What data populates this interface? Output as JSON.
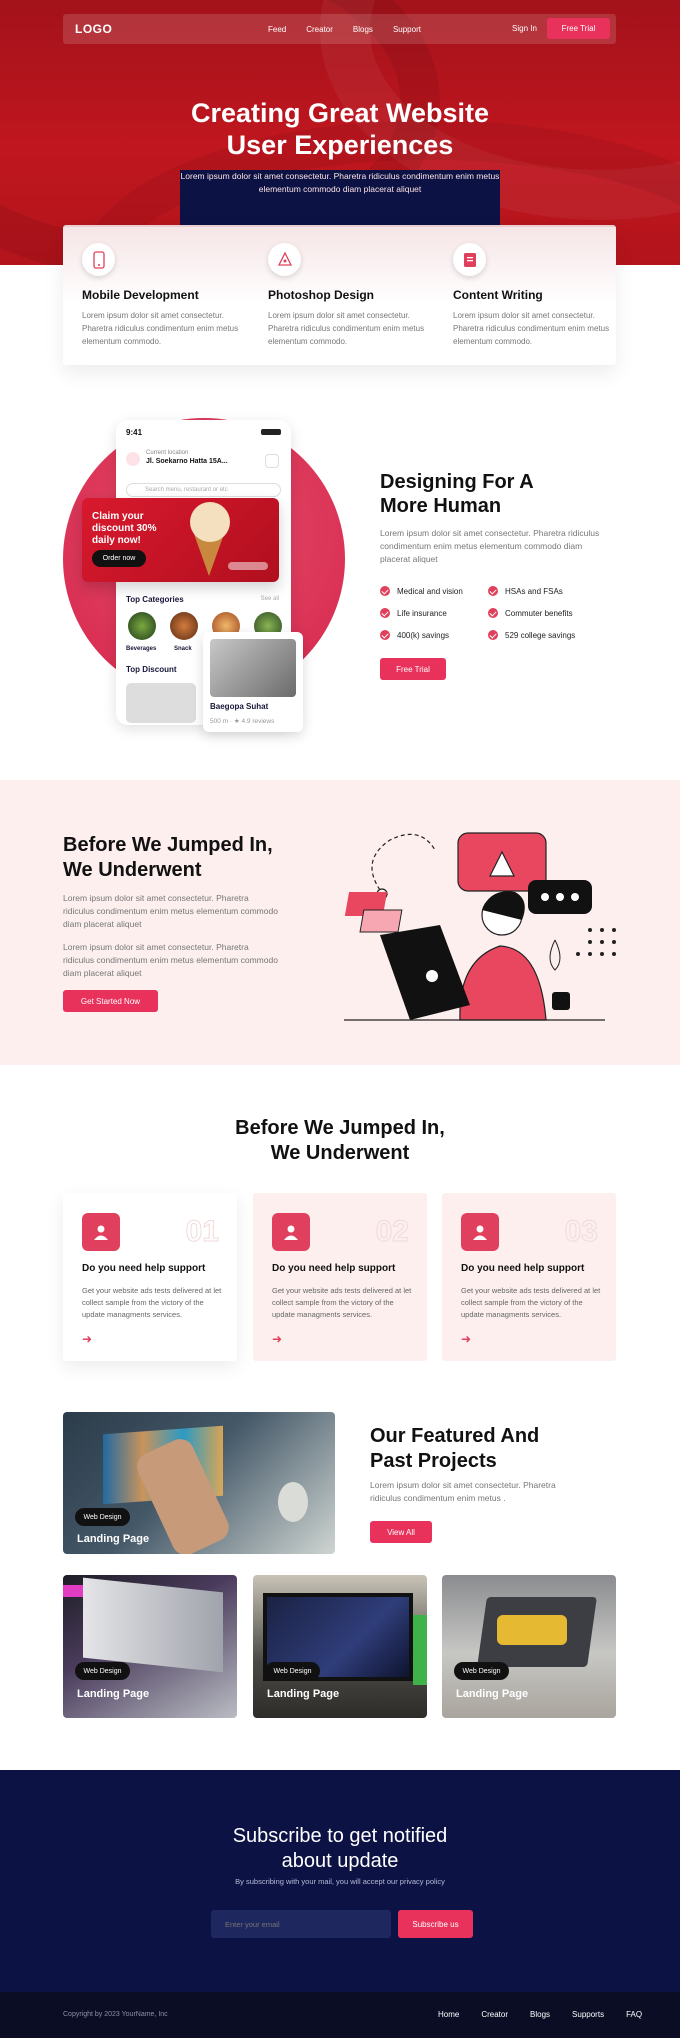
{
  "nav": {
    "logo": "LOGO",
    "links": [
      "Feed",
      "Creator",
      "Blogs",
      "Support"
    ],
    "signin": "Sign In",
    "cta": "Free Trial"
  },
  "hero": {
    "title_line1": "Creating Great Website",
    "title_line2": "User Experiences",
    "subtitle": "Lorem ipsum dolor sit amet consectetur. Pharetra ridiculus condimentum enim metus elementum commodo diam placerat aliquet"
  },
  "services": [
    {
      "title": "Mobile Development",
      "text": "Lorem ipsum dolor sit amet consectetur. Pharetra ridiculus condimentum enim metus elementum commodo.",
      "icon": "phone-icon"
    },
    {
      "title": "Photoshop Design",
      "text": "Lorem ipsum dolor sit amet consectetur. Pharetra ridiculus condimentum enim metus elementum commodo.",
      "icon": "pen-tool-icon"
    },
    {
      "title": "Content Writing",
      "text": "Lorem ipsum dolor sit amet consectetur. Pharetra ridiculus condimentum enim metus elementum commodo.",
      "icon": "document-icon"
    }
  ],
  "app_mock": {
    "time": "9:41",
    "location_label": "Current location",
    "location": "Jl. Soekarno Hatta 15A...",
    "search_placeholder": "Search menu, restaurant or etc",
    "promo_line1": "Claim your",
    "promo_line2": "discount 30%",
    "promo_line3": "daily now!",
    "promo_button": "Order now",
    "categories_title": "Top Categories",
    "see_all": "See all",
    "category_1": "Beverages",
    "category_2": "Snack",
    "discount_title": "Top Discount",
    "restaurant_name": "Baegopa Suhat",
    "restaurant_meta": "500 m · ★ 4.9 reviews"
  },
  "human": {
    "title_line1": "Designing For A",
    "title_line2": "More Human",
    "text": "Lorem ipsum dolor sit amet consectetur. Pharetra ridiculus condimentum enim metus elementum commodo diam placerat aliquet",
    "features": [
      "Medical and vision",
      "HSAs and FSAs",
      "Life insurance",
      "Commuter benefits",
      "400(k) savings",
      "529 college savings"
    ],
    "cta": "Free Trial"
  },
  "jumped": {
    "title_line1": "Before We Jumped In,",
    "title_line2": "We Underwent",
    "text1": "Lorem ipsum dolor sit amet consectetur. Pharetra ridiculus condimentum enim metus elementum commodo diam placerat aliquet",
    "text2": "Lorem ipsum dolor sit amet consectetur. Pharetra ridiculus condimentum enim metus elementum commodo diam placerat aliquet",
    "cta": "Get Started Now"
  },
  "steps": {
    "title_line1": "Before We Jumped In,",
    "title_line2": "We Underwent",
    "cards": [
      {
        "num": "01",
        "title": "Do you need help support",
        "text": "Get your website ads tests delivered at let collect sample from the victory of the update managments services."
      },
      {
        "num": "02",
        "title": "Do you need help support",
        "text": "Get your website ads tests delivered at let collect sample from the victory of the update managments services."
      },
      {
        "num": "03",
        "title": "Do you need help support",
        "text": "Get your website ads tests delivered at let collect sample from the victory of the update managments services."
      }
    ]
  },
  "projects": {
    "title_line1": "Our Featured And",
    "title_line2": "Past Projects",
    "text": "Lorem ipsum dolor sit amet consectetur. Pharetra ridiculus condimentum enim metus .",
    "cta": "View All",
    "items": [
      {
        "tag": "Web Design",
        "title": "Landing Page"
      },
      {
        "tag": "Web Design",
        "title": "Landing Page"
      },
      {
        "tag": "Web Design",
        "title": "Landing Page"
      },
      {
        "tag": "Web Design",
        "title": "Landing Page"
      }
    ]
  },
  "subscribe": {
    "title_line1": "Subscribe to get notified",
    "title_line2": "about update",
    "text": "By subscribing with your mail, you will accept our privacy policy",
    "placeholder": "Enter your email",
    "cta": "Subscribe us"
  },
  "footer": {
    "copyright": "Copyright by 2023 YourName, Inc",
    "links": [
      "Home",
      "Creator",
      "Blogs",
      "Supports",
      "FAQ"
    ]
  },
  "colors": {
    "accent": "#e8315b",
    "hero_red": "#b3141b",
    "navy": "#0c1244",
    "blush": "#fcefee"
  }
}
